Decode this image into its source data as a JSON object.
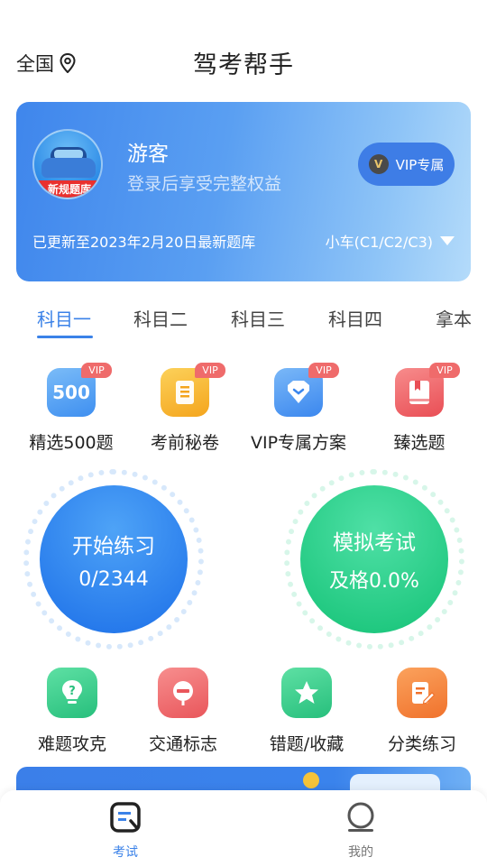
{
  "header": {
    "location": "全国",
    "title": "驾考帮手"
  },
  "user_card": {
    "avatar_banner": "新规题库",
    "username": "游客",
    "subtitle": "登录后享受完整权益",
    "vip_button": "VIP专属",
    "vip_badge": "V",
    "update_text": "已更新至2023年2月20日最新题库",
    "car_type": "小车(C1/C2/C3)"
  },
  "tabs": [
    {
      "label": "科目一",
      "active": true
    },
    {
      "label": "科目二",
      "active": false
    },
    {
      "label": "科目三",
      "active": false
    },
    {
      "label": "科目四",
      "active": false
    },
    {
      "label": "拿本",
      "active": false
    }
  ],
  "features_top": [
    {
      "label": "精选500题",
      "icon": "500-icon",
      "tag": "VIP",
      "icon_text": "500",
      "color": "#5ca7f5"
    },
    {
      "label": "考前秘卷",
      "icon": "scroll-icon",
      "tag": "VIP",
      "color": "#f7b52c"
    },
    {
      "label": "VIP专属方案",
      "icon": "diamond-icon",
      "tag": "VIP",
      "color": "#4c9cf2"
    },
    {
      "label": "臻选题",
      "icon": "book-icon",
      "tag": "VIP",
      "color": "#f0696a"
    }
  ],
  "big_buttons": {
    "practice": {
      "line1": "开始练习",
      "line2": "0/2344",
      "color": "#2f8cf0"
    },
    "exam": {
      "line1": "模拟考试",
      "line2": "及格0.0%",
      "color": "#2fd495"
    }
  },
  "features_bottom": [
    {
      "label": "难题攻克",
      "icon": "lightbulb-icon",
      "color": "#36c98a"
    },
    {
      "label": "交通标志",
      "icon": "traffic-sign-icon",
      "color": "#f06c6c"
    },
    {
      "label": "错题/收藏",
      "icon": "star-icon",
      "color": "#36c98a"
    },
    {
      "label": "分类练习",
      "icon": "edit-note-icon",
      "color": "#f58a3c"
    }
  ],
  "bottom_nav": [
    {
      "label": "考试",
      "icon": "exam-icon",
      "active": true
    },
    {
      "label": "我的",
      "icon": "profile-icon",
      "active": false
    }
  ],
  "colors": {
    "accent": "#3b82e8",
    "vip_tag": "#ef6b6b"
  }
}
